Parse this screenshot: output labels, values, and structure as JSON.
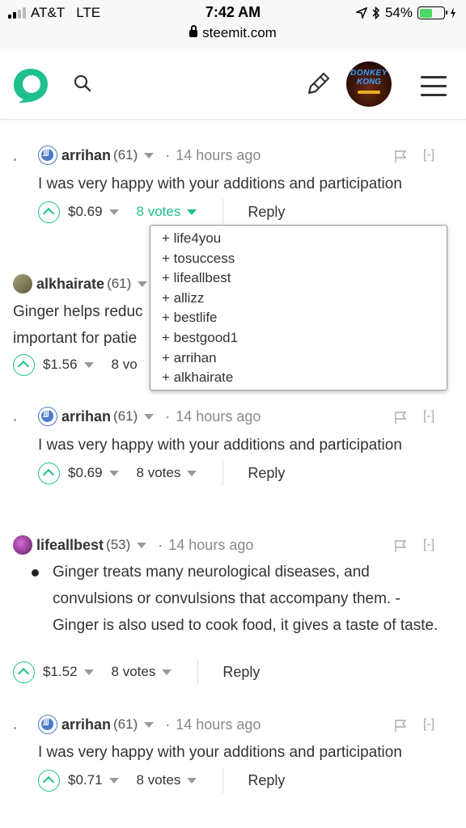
{
  "status_bar": {
    "carrier": "AT&T",
    "network": "LTE",
    "time": "7:42 AM",
    "url": "steemit.com",
    "battery_percent": "54%",
    "battery_level": 0.54
  },
  "header": {
    "logo_icon": "steemit-logo-icon",
    "search_icon": "search-icon",
    "submit_icon": "pencil-icon",
    "avatar_text_line1": "DONKEY",
    "avatar_text_line2": "KONG",
    "menu_icon": "hamburger-menu-icon"
  },
  "colors": {
    "accent": "#1fbf8f",
    "text": "#333333",
    "muted": "#888888"
  },
  "comments": [
    {
      "author": "arrihan",
      "reputation": "(61)",
      "time": "14 hours ago",
      "collapse": "[-]",
      "body": [
        "I was very happy with your additions and participation"
      ],
      "payout": "$0.69",
      "votes": "8 votes",
      "reply": "Reply"
    },
    {
      "author": "alkhairate",
      "reputation": "(61)",
      "time": "",
      "body": [
        "Ginger helps reduc",
        "important for patie"
      ],
      "payout": "$1.56",
      "votes": "8 vo",
      "reply": ""
    },
    {
      "author": "arrihan",
      "reputation": "(61)",
      "time": "14 hours ago",
      "collapse": "[-]",
      "body": [
        "I was very happy with your additions and participation"
      ],
      "payout": "$0.69",
      "votes": "8 votes",
      "reply": "Reply"
    },
    {
      "author": "lifeallbest",
      "reputation": "(53)",
      "time": "14 hours ago",
      "collapse": "[-]",
      "body": [
        "Ginger treats many neurological diseases, and",
        "convulsions or convulsions that accompany them. -",
        "Ginger is also used to cook food, it gives a taste of taste."
      ],
      "payout": "$1.52",
      "votes": "8 votes",
      "reply": "Reply"
    },
    {
      "author": "arrihan",
      "reputation": "(61)",
      "time": "14 hours ago",
      "collapse": "[-]",
      "body": [
        "I was very happy with your additions and participation"
      ],
      "payout": "$0.71",
      "votes": "8 votes",
      "reply": "Reply"
    }
  ],
  "vote_dropdown": {
    "voters": [
      "+ life4you",
      "+ tosuccess",
      "+ lifeallbest",
      "+ allizz",
      "+ bestlife",
      "+ bestgood1",
      "+ arrihan",
      "+ alkhairate"
    ]
  }
}
